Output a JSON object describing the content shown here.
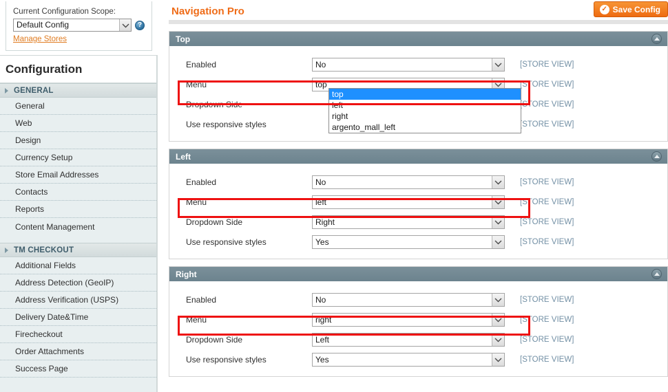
{
  "scope": {
    "label": "Current Configuration Scope:",
    "selected": "Default Config",
    "help_icon": "help-circle-icon",
    "manage_stores_link": "Manage Stores"
  },
  "config_panel": {
    "title": "Configuration",
    "groups": [
      {
        "label": "GENERAL",
        "items": [
          "General",
          "Web",
          "Design",
          "Currency Setup",
          "Store Email Addresses",
          "Contacts",
          "Reports",
          "Content Management"
        ]
      },
      {
        "label": "TM CHECKOUT",
        "items": [
          "Additional Fields",
          "Address Detection (GeoIP)",
          "Address Verification (USPS)",
          "Delivery Date&Time",
          "Firecheckout",
          "Order Attachments",
          "Success Page"
        ]
      }
    ]
  },
  "page": {
    "title": "Navigation Pro",
    "save_label": "Save Config",
    "save_icon": "check-circle-icon",
    "accent_color": "#ef6c18",
    "highlight_color": "#ee1111",
    "section_header_color": "#6c838e",
    "scope_tag_color": "#7390a5"
  },
  "sections": [
    {
      "title": "Top",
      "collapse_icon": "chevron-up-circle-icon",
      "rows": [
        {
          "label": "Enabled",
          "value": "No",
          "scope": "[STORE VIEW]"
        },
        {
          "label": "Menu",
          "value": "top",
          "scope": "[STORE VIEW]",
          "highlighted": true,
          "open": true
        },
        {
          "label": "Dropdown Side",
          "value": "",
          "scope": "[STORE VIEW]"
        },
        {
          "label": "Use responsive styles",
          "value": "",
          "scope": "[STORE VIEW]"
        }
      ],
      "dropdown_options": [
        "top",
        "left",
        "right",
        "argento_mall_left"
      ],
      "dropdown_selected": "top"
    },
    {
      "title": "Left",
      "collapse_icon": "chevron-up-circle-icon",
      "rows": [
        {
          "label": "Enabled",
          "value": "No",
          "scope": "[STORE VIEW]"
        },
        {
          "label": "Menu",
          "value": "left",
          "scope": "[STORE VIEW]",
          "highlighted": true
        },
        {
          "label": "Dropdown Side",
          "value": "Right",
          "scope": "[STORE VIEW]"
        },
        {
          "label": "Use responsive styles",
          "value": "Yes",
          "scope": "[STORE VIEW]"
        }
      ]
    },
    {
      "title": "Right",
      "collapse_icon": "chevron-up-circle-icon",
      "rows": [
        {
          "label": "Enabled",
          "value": "No",
          "scope": "[STORE VIEW]"
        },
        {
          "label": "Menu",
          "value": "right",
          "scope": "[STORE VIEW]",
          "highlighted": true
        },
        {
          "label": "Dropdown Side",
          "value": "Left",
          "scope": "[STORE VIEW]"
        },
        {
          "label": "Use responsive styles",
          "value": "Yes",
          "scope": "[STORE VIEW]"
        }
      ]
    }
  ]
}
